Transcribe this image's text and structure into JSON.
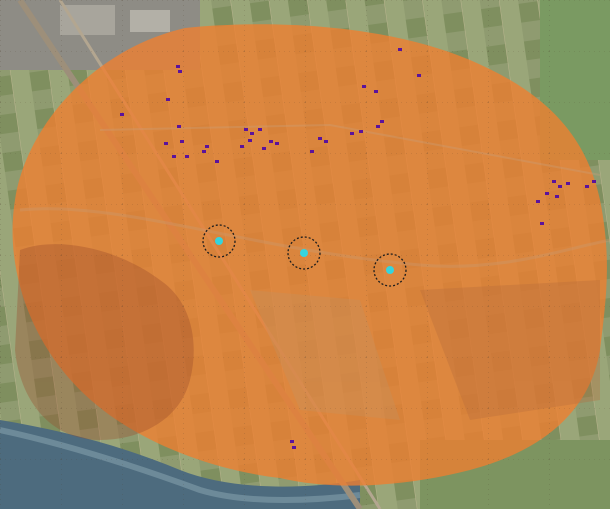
{
  "map": {
    "layers": {
      "aerial_photo": {
        "visible": true
      },
      "risk_contour": {
        "visible": true,
        "color": "#f07f2f",
        "opacity": 0.78
      },
      "buildings": {
        "visible": true,
        "color": "#5b139b"
      },
      "turbines": {
        "visible": true,
        "marker_color": "#35d4dd",
        "ring_color": "#1d1d1d",
        "ring_style": "dashed"
      }
    },
    "turbines": [
      {
        "id": "turbine-1"
      },
      {
        "id": "turbine-2"
      },
      {
        "id": "turbine-3"
      }
    ],
    "buildings_count": 42,
    "grid": {
      "visible": true,
      "style": "dotted"
    }
  }
}
